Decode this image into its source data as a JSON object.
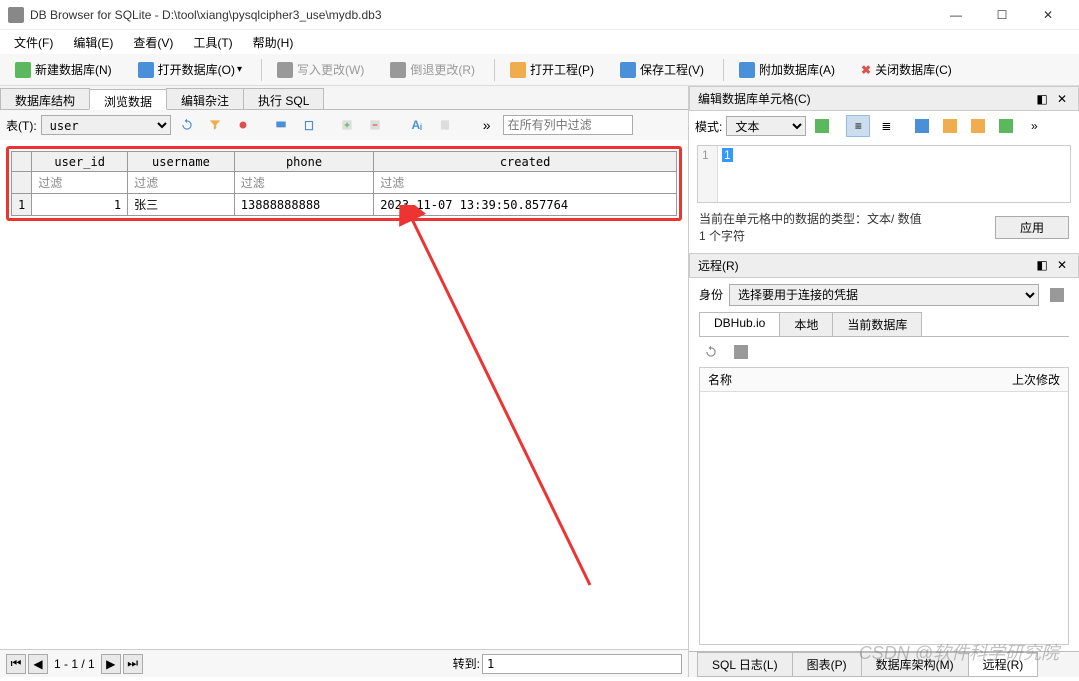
{
  "window": {
    "title": "DB Browser for SQLite - D:\\tool\\xiang\\pysqlcipher3_use\\mydb.db3"
  },
  "menu": {
    "file": "文件(F)",
    "edit": "编辑(E)",
    "view": "查看(V)",
    "tools": "工具(T)",
    "help": "帮助(H)"
  },
  "toolbar": {
    "new_db": "新建数据库(N)",
    "open_db": "打开数据库(O)",
    "write_changes": "写入更改(W)",
    "revert_changes": "倒退更改(R)",
    "open_proj": "打开工程(P)",
    "save_proj": "保存工程(V)",
    "attach_db": "附加数据库(A)",
    "close_db": "关闭数据库(C)"
  },
  "tabs": {
    "structure": "数据库结构",
    "browse": "浏览数据",
    "pragmas": "编辑杂注",
    "sql": "执行 SQL"
  },
  "browse": {
    "table_label": "表(T):",
    "table_select": "user",
    "filter_placeholder": "在所有列中过滤",
    "goto_arrow": "»"
  },
  "grid": {
    "headers": {
      "rownum": "",
      "user_id": "user_id",
      "username": "username",
      "phone": "phone",
      "created": "created"
    },
    "filter_text": "过滤",
    "rows": [
      {
        "n": "1",
        "user_id": "1",
        "username": "张三",
        "phone": "13888888888",
        "created": "2023-11-07 13:39:50.857764"
      }
    ]
  },
  "pager": {
    "range": "1 - 1 / 1",
    "goto_label": "转到:",
    "goto_value": "1"
  },
  "cell_panel": {
    "title": "编辑数据库单元格(C)",
    "mode_label": "模式:",
    "mode_value": "文本",
    "line_no": "1",
    "text_value": "1",
    "info_line1": "当前在单元格中的数据的类型：文本/ 数值",
    "info_line2": "1 个字符",
    "apply": "应用"
  },
  "remote": {
    "title": "远程(R)",
    "identity_label": "身份",
    "identity_value": "选择要用于连接的凭据",
    "tabs": {
      "dbhub": "DBHub.io",
      "local": "本地",
      "current": "当前数据库"
    },
    "col_name": "名称",
    "col_modified": "上次修改"
  },
  "bottom_tabs": {
    "sql_log": "SQL 日志(L)",
    "plot": "图表(P)",
    "schema": "数据库架构(M)",
    "remote": "远程(R)"
  },
  "watermark": "CSDN @软件科学研究院"
}
